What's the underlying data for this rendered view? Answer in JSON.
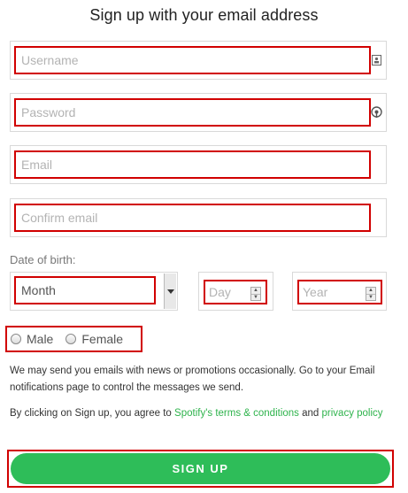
{
  "title": "Sign up with your email address",
  "fields": {
    "username": {
      "placeholder": "Username"
    },
    "password": {
      "placeholder": "Password"
    },
    "email": {
      "placeholder": "Email"
    },
    "confirm_email": {
      "placeholder": "Confirm email"
    }
  },
  "dob": {
    "label": "Date of birth:",
    "month": "Month",
    "day_placeholder": "Day",
    "year_placeholder": "Year"
  },
  "gender": {
    "male": "Male",
    "female": "Female"
  },
  "emails_note": "We may send you emails with news or promotions occasionally. Go to your Email notifications page to control the messages we send.",
  "terms": {
    "prefix": "By clicking on Sign up, you agree to ",
    "terms_link": "Spotify's terms & conditions",
    "and": " and ",
    "privacy_link": "privacy policy"
  },
  "signup_button": "SIGN UP",
  "icons": {
    "username": "contact-card-icon",
    "password": "password-key-icon",
    "month": "dropdown-arrow-icon",
    "spinner": "spinner-arrows-icon",
    "radio": "radio-button-icon"
  },
  "colors": {
    "accent": "#2ebd59",
    "link": "#2eb34c",
    "highlight": "#d10000"
  }
}
